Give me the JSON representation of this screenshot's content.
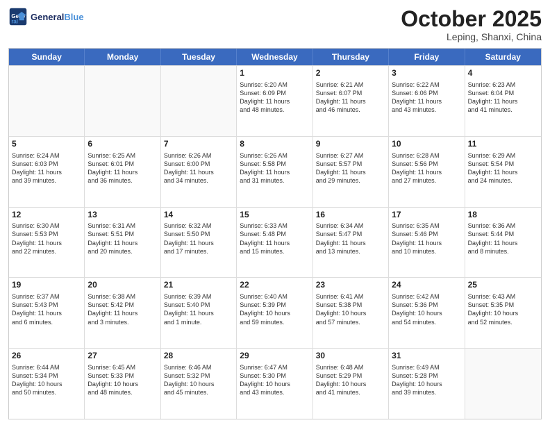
{
  "header": {
    "logo_general": "General",
    "logo_blue": "Blue",
    "month": "October 2025",
    "location": "Leping, Shanxi, China"
  },
  "weekdays": [
    "Sunday",
    "Monday",
    "Tuesday",
    "Wednesday",
    "Thursday",
    "Friday",
    "Saturday"
  ],
  "weeks": [
    [
      {
        "day": "",
        "info": ""
      },
      {
        "day": "",
        "info": ""
      },
      {
        "day": "",
        "info": ""
      },
      {
        "day": "1",
        "info": "Sunrise: 6:20 AM\nSunset: 6:09 PM\nDaylight: 11 hours\nand 48 minutes."
      },
      {
        "day": "2",
        "info": "Sunrise: 6:21 AM\nSunset: 6:07 PM\nDaylight: 11 hours\nand 46 minutes."
      },
      {
        "day": "3",
        "info": "Sunrise: 6:22 AM\nSunset: 6:06 PM\nDaylight: 11 hours\nand 43 minutes."
      },
      {
        "day": "4",
        "info": "Sunrise: 6:23 AM\nSunset: 6:04 PM\nDaylight: 11 hours\nand 41 minutes."
      }
    ],
    [
      {
        "day": "5",
        "info": "Sunrise: 6:24 AM\nSunset: 6:03 PM\nDaylight: 11 hours\nand 39 minutes."
      },
      {
        "day": "6",
        "info": "Sunrise: 6:25 AM\nSunset: 6:01 PM\nDaylight: 11 hours\nand 36 minutes."
      },
      {
        "day": "7",
        "info": "Sunrise: 6:26 AM\nSunset: 6:00 PM\nDaylight: 11 hours\nand 34 minutes."
      },
      {
        "day": "8",
        "info": "Sunrise: 6:26 AM\nSunset: 5:58 PM\nDaylight: 11 hours\nand 31 minutes."
      },
      {
        "day": "9",
        "info": "Sunrise: 6:27 AM\nSunset: 5:57 PM\nDaylight: 11 hours\nand 29 minutes."
      },
      {
        "day": "10",
        "info": "Sunrise: 6:28 AM\nSunset: 5:56 PM\nDaylight: 11 hours\nand 27 minutes."
      },
      {
        "day": "11",
        "info": "Sunrise: 6:29 AM\nSunset: 5:54 PM\nDaylight: 11 hours\nand 24 minutes."
      }
    ],
    [
      {
        "day": "12",
        "info": "Sunrise: 6:30 AM\nSunset: 5:53 PM\nDaylight: 11 hours\nand 22 minutes."
      },
      {
        "day": "13",
        "info": "Sunrise: 6:31 AM\nSunset: 5:51 PM\nDaylight: 11 hours\nand 20 minutes."
      },
      {
        "day": "14",
        "info": "Sunrise: 6:32 AM\nSunset: 5:50 PM\nDaylight: 11 hours\nand 17 minutes."
      },
      {
        "day": "15",
        "info": "Sunrise: 6:33 AM\nSunset: 5:48 PM\nDaylight: 11 hours\nand 15 minutes."
      },
      {
        "day": "16",
        "info": "Sunrise: 6:34 AM\nSunset: 5:47 PM\nDaylight: 11 hours\nand 13 minutes."
      },
      {
        "day": "17",
        "info": "Sunrise: 6:35 AM\nSunset: 5:46 PM\nDaylight: 11 hours\nand 10 minutes."
      },
      {
        "day": "18",
        "info": "Sunrise: 6:36 AM\nSunset: 5:44 PM\nDaylight: 11 hours\nand 8 minutes."
      }
    ],
    [
      {
        "day": "19",
        "info": "Sunrise: 6:37 AM\nSunset: 5:43 PM\nDaylight: 11 hours\nand 6 minutes."
      },
      {
        "day": "20",
        "info": "Sunrise: 6:38 AM\nSunset: 5:42 PM\nDaylight: 11 hours\nand 3 minutes."
      },
      {
        "day": "21",
        "info": "Sunrise: 6:39 AM\nSunset: 5:40 PM\nDaylight: 11 hours\nand 1 minute."
      },
      {
        "day": "22",
        "info": "Sunrise: 6:40 AM\nSunset: 5:39 PM\nDaylight: 10 hours\nand 59 minutes."
      },
      {
        "day": "23",
        "info": "Sunrise: 6:41 AM\nSunset: 5:38 PM\nDaylight: 10 hours\nand 57 minutes."
      },
      {
        "day": "24",
        "info": "Sunrise: 6:42 AM\nSunset: 5:36 PM\nDaylight: 10 hours\nand 54 minutes."
      },
      {
        "day": "25",
        "info": "Sunrise: 6:43 AM\nSunset: 5:35 PM\nDaylight: 10 hours\nand 52 minutes."
      }
    ],
    [
      {
        "day": "26",
        "info": "Sunrise: 6:44 AM\nSunset: 5:34 PM\nDaylight: 10 hours\nand 50 minutes."
      },
      {
        "day": "27",
        "info": "Sunrise: 6:45 AM\nSunset: 5:33 PM\nDaylight: 10 hours\nand 48 minutes."
      },
      {
        "day": "28",
        "info": "Sunrise: 6:46 AM\nSunset: 5:32 PM\nDaylight: 10 hours\nand 45 minutes."
      },
      {
        "day": "29",
        "info": "Sunrise: 6:47 AM\nSunset: 5:30 PM\nDaylight: 10 hours\nand 43 minutes."
      },
      {
        "day": "30",
        "info": "Sunrise: 6:48 AM\nSunset: 5:29 PM\nDaylight: 10 hours\nand 41 minutes."
      },
      {
        "day": "31",
        "info": "Sunrise: 6:49 AM\nSunset: 5:28 PM\nDaylight: 10 hours\nand 39 minutes."
      },
      {
        "day": "",
        "info": ""
      }
    ]
  ]
}
